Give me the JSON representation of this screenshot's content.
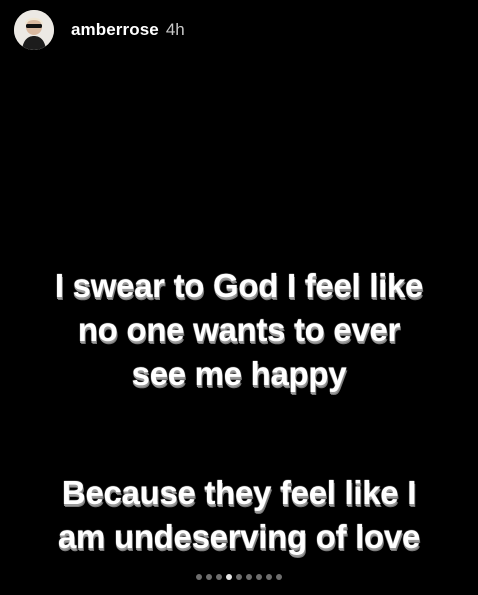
{
  "header": {
    "username": "amberrose",
    "time": "4h",
    "avatar_icon": "profile-photo"
  },
  "caption_1": {
    "lines": [
      "I swear to God I feel like",
      "no one wants to ever",
      "see me happy"
    ]
  },
  "caption_2": {
    "lines": [
      "Because they feel like I",
      "am undeserving of love"
    ]
  },
  "pagination": {
    "total": 9,
    "active": 4
  },
  "colors": {
    "background": "#000000",
    "text": "#ffffff",
    "dot_inactive": "#6e6e6e",
    "dot_active": "#e8e8e8"
  }
}
